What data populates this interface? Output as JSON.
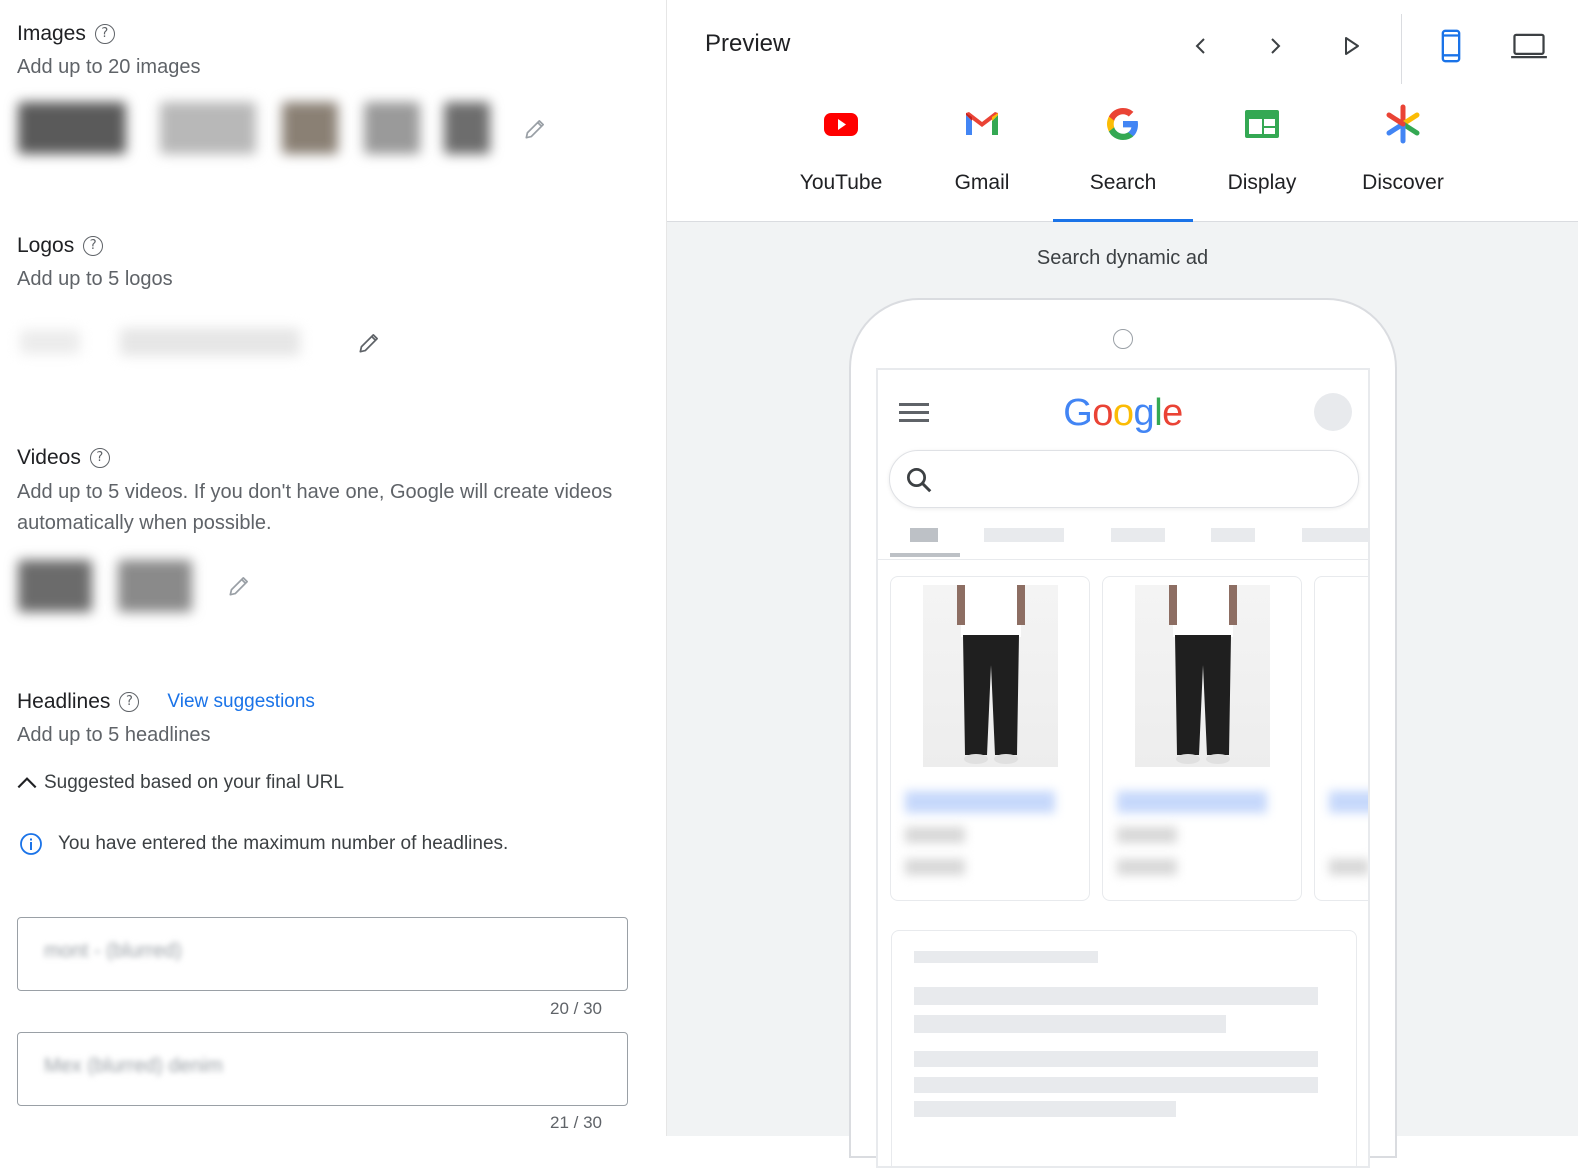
{
  "assets": {
    "images": {
      "title": "Images",
      "subtitle": "Add up to 20 images"
    },
    "logos": {
      "title": "Logos",
      "subtitle": "Add up to 5 logos"
    },
    "videos": {
      "title": "Videos",
      "subtitle": "Add up to 5 videos. If you don't have one, Google will create videos automatically when possible."
    },
    "headlines": {
      "title": "Headlines",
      "view_suggestions": "View suggestions",
      "subtitle": "Add up to 5 headlines",
      "suggested_toggle": "Suggested based on your final URL",
      "info_message": "You have entered the maximum number of headlines.",
      "fields": [
        {
          "value": "mont - (blurred)",
          "counter": "20 / 30"
        },
        {
          "value": "Mex (blurred) denim",
          "counter": "21 / 30"
        }
      ]
    }
  },
  "preview": {
    "title": "Preview",
    "tabs": [
      {
        "label": "YouTube",
        "icon": "youtube-icon",
        "active": false
      },
      {
        "label": "Gmail",
        "icon": "gmail-icon",
        "active": false
      },
      {
        "label": "Search",
        "icon": "google-g-icon",
        "active": true
      },
      {
        "label": "Display",
        "icon": "display-icon",
        "active": false
      },
      {
        "label": "Discover",
        "icon": "discover-icon",
        "active": false
      }
    ],
    "caption": "Search dynamic ad",
    "phone": {
      "logo": "Google"
    }
  },
  "colors": {
    "accent": "#1a73e8",
    "google_blue": "#4285F4",
    "google_red": "#EA4335",
    "google_yellow": "#FBBC05",
    "google_green": "#34A853"
  }
}
